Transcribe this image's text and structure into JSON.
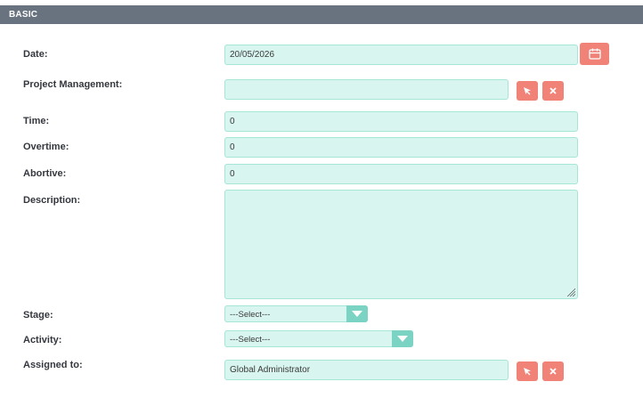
{
  "panel": {
    "title": "BASIC"
  },
  "fields": {
    "date": {
      "label": "Date:",
      "value": "20/05/2026"
    },
    "project": {
      "label": "Project Management:",
      "value": ""
    },
    "time": {
      "label": "Time:",
      "value": "0"
    },
    "overtime": {
      "label": "Overtime:",
      "value": "0"
    },
    "abortive": {
      "label": "Abortive:",
      "value": "0"
    },
    "description": {
      "label": "Description:",
      "value": ""
    },
    "stage": {
      "label": "Stage:",
      "selected": "---Select---"
    },
    "activity": {
      "label": "Activity:",
      "selected": "---Select---"
    },
    "assigned": {
      "label": "Assigned to:",
      "value": "Global Administrator"
    }
  },
  "icons": {
    "calendar": "calendar-icon",
    "select": "select-arrow-icon",
    "clear": "clear-x-icon",
    "dropdown": "chevron-down-icon"
  },
  "colors": {
    "header_bg": "#69737f",
    "field_bg": "#d8f5ef",
    "field_border": "#a5e6d6",
    "button": "#f08277",
    "dropdown_arrow_bg": "#7ad3c3"
  }
}
